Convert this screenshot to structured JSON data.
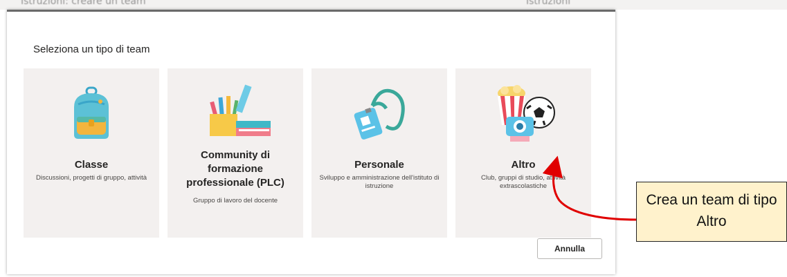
{
  "background": {
    "ghost_left": "Istruzioni: creare un team",
    "ghost_right": "Istruzioni"
  },
  "dialog": {
    "title": "Seleziona un tipo di team",
    "cards": [
      {
        "name": "Classe",
        "description": "Discussioni, progetti di gruppo, attività",
        "icon": "backpack-icon"
      },
      {
        "name": "Community di formazione professionale (PLC)",
        "description": "Gruppo di lavoro del docente",
        "icon": "books-pencils-icon"
      },
      {
        "name": "Personale",
        "description": "Sviluppo e amministrazione dell'istituto di istruzione",
        "icon": "lanyard-badge-icon"
      },
      {
        "name": "Altro",
        "description": "Club, gruppi di studio, attività extrascolastiche",
        "icon": "popcorn-ball-camera-icon"
      }
    ],
    "cancel_label": "Annulla"
  },
  "callout": {
    "text": "Crea un team di tipo Altro"
  },
  "colors": {
    "card_bg": "#f3f0ef",
    "callout_bg": "#fff2cc",
    "arrow": "#e00000"
  }
}
